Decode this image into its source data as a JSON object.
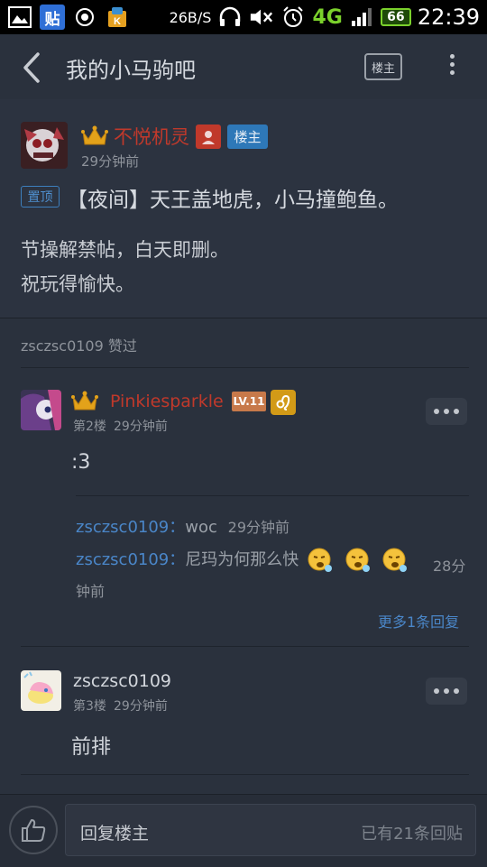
{
  "status_bar": {
    "tieba_badge": "贴",
    "net_speed": "26B/S",
    "network": "4G",
    "battery": "66",
    "time": "22:39"
  },
  "header": {
    "title": "我的小马驹吧",
    "op_button": "楼主"
  },
  "main_post": {
    "author": "不悦机灵",
    "author_tag": "楼主",
    "time": "29分钟前",
    "pin_tag": "置顶",
    "title": "【夜间】天王盖地虎，小马撞鲍鱼。",
    "body_line1": "节操解禁帖，白天即删。",
    "body_line2": "祝玩得愉快。"
  },
  "likes": "zsczsc0109 赞过",
  "floors": [
    {
      "author": "Pinkiesparkle",
      "level": "LV.11",
      "floor": "第2楼",
      "time": "29分钟前",
      "content": ":3",
      "replies": [
        {
          "user": "zsczsc0109：",
          "text": "woc",
          "time": "29分钟前"
        },
        {
          "user": "zsczsc0109：",
          "text": "尼玛为何那么快",
          "time_a": "28分",
          "time_b": "钟前"
        }
      ],
      "more_replies": "更多1条回复"
    },
    {
      "author": "zsczsc0109",
      "floor": "第3楼",
      "time": "29分钟前",
      "content": "前排"
    }
  ],
  "bottom_bar": {
    "reply_placeholder": "回复楼主",
    "reply_count": "已有21条回贴"
  },
  "colors": {
    "background": "#2a313d",
    "link_blue": "#4a86c8",
    "author_red": "#c0392b",
    "tag_blue": "#2e78b8"
  }
}
